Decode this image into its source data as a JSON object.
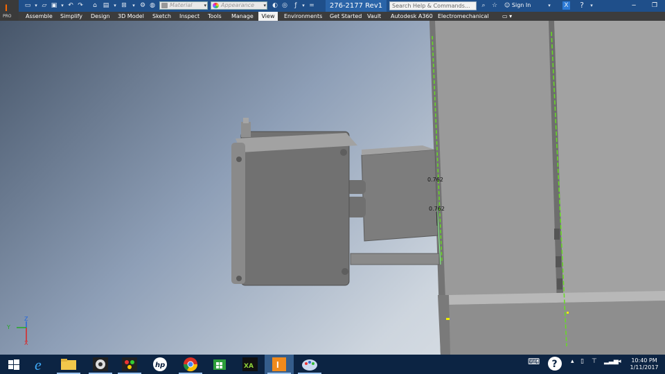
{
  "app": {
    "logo_letter": "I",
    "logo_badge": "PRO",
    "document_title": "276-2177 Rev1",
    "search_placeholder": "Search Help & Commands...",
    "sign_in_label": "Sign In",
    "material_placeholder": "Material",
    "appearance_placeholder": "Appearance"
  },
  "ribbon": {
    "tabs": [
      {
        "label": "Assemble"
      },
      {
        "label": "Simplify"
      },
      {
        "label": "Design"
      },
      {
        "label": "3D Model"
      },
      {
        "label": "Sketch"
      },
      {
        "label": "Inspect"
      },
      {
        "label": "Tools"
      },
      {
        "label": "Manage"
      },
      {
        "label": "View",
        "active": true
      },
      {
        "label": "Environments"
      },
      {
        "label": "Get Started"
      },
      {
        "label": "Vault"
      },
      {
        "label": "Autodesk A360"
      },
      {
        "label": "Electromechanical"
      }
    ]
  },
  "viewport": {
    "dimensions": [
      "0.762",
      "0.762"
    ],
    "triad": {
      "x_label": "X",
      "y_label": "Y",
      "z_label": "Z"
    }
  },
  "taskbar": {
    "items": [
      {
        "name": "start-icon"
      },
      {
        "name": "internet-explorer-icon"
      },
      {
        "name": "file-explorer-icon"
      },
      {
        "name": "webcam-app-icon"
      },
      {
        "name": "paint-app-icon"
      },
      {
        "name": "hp-icon"
      },
      {
        "name": "chrome-icon"
      },
      {
        "name": "store-icon"
      },
      {
        "name": "xilinx-icon"
      },
      {
        "name": "inventor-icon"
      },
      {
        "name": "paint-palette-icon"
      }
    ],
    "clock_time": "10:40 PM",
    "clock_date": "1/11/2017"
  },
  "colors": {
    "accent": "#1f4f8a",
    "tab_bar": "#3c3c3c",
    "taskbar": "#0c2443",
    "edge_highlight": "#66dd22"
  }
}
